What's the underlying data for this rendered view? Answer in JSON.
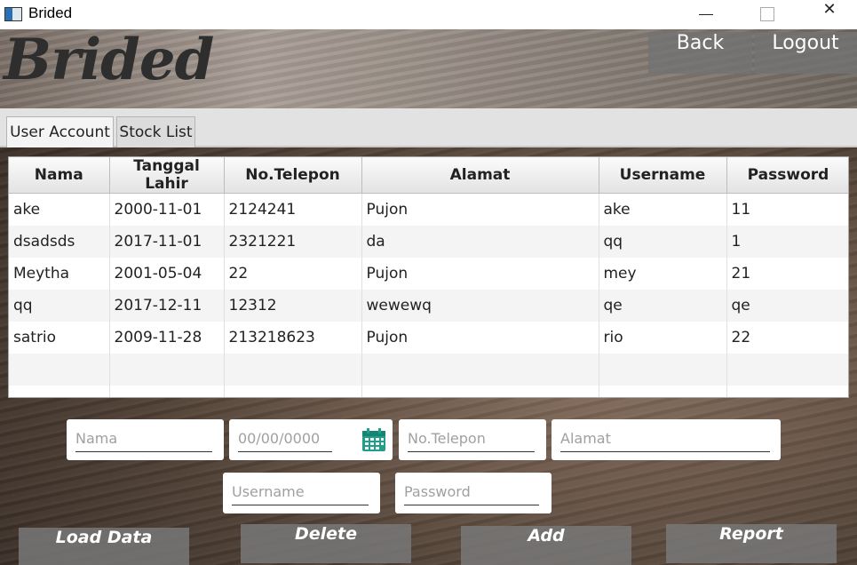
{
  "window": {
    "title": "Brided"
  },
  "header": {
    "brand": "Brided",
    "back_label": "Back",
    "logout_label": "Logout"
  },
  "tabs": [
    {
      "label": "User Account"
    },
    {
      "label": "Stock List"
    }
  ],
  "table": {
    "columns": [
      "Nama",
      "Tanggal Lahir",
      "No.Telepon",
      "Alamat",
      "Username",
      "Password"
    ],
    "rows": [
      [
        "ake",
        "2000-11-01",
        "2124241",
        "Pujon",
        "ake",
        "11"
      ],
      [
        "dsadsds",
        "2017-11-01",
        "2321221",
        "da",
        "qq",
        "1"
      ],
      [
        "Meytha",
        "2001-05-04",
        "22",
        "Pujon",
        "mey",
        "21"
      ],
      [
        "qq",
        "2017-12-11",
        "12312",
        "wewewq",
        "qe",
        "qe"
      ],
      [
        "satrio",
        "2009-11-28",
        "213218623",
        "Pujon",
        "rio",
        "22"
      ]
    ]
  },
  "form": {
    "nama_placeholder": "Nama",
    "tanggal_placeholder": "00/00/0000",
    "telepon_placeholder": "No.Telepon",
    "alamat_placeholder": "Alamat",
    "username_placeholder": "Username",
    "password_placeholder": "Password"
  },
  "actions": {
    "load_label": "Load Data",
    "delete_label": "Delete",
    "add_label": "Add",
    "report_label": "Report"
  },
  "icons": {
    "calendar": "calendar-icon",
    "accent": "#1f9e8a"
  }
}
